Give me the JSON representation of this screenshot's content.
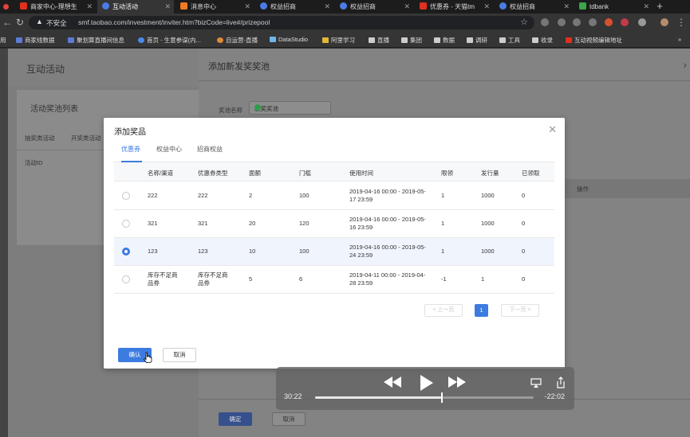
{
  "browser": {
    "tabs": [
      {
        "title": "商家中心-理想生",
        "icon": "taobao-t-icon",
        "active": false
      },
      {
        "title": "互动活动",
        "icon": "workbench-icon",
        "active": true
      },
      {
        "title": "消息中心",
        "icon": "message-icon",
        "active": false
      },
      {
        "title": "权益招商",
        "icon": "workbench-icon",
        "active": false
      },
      {
        "title": "权益招商",
        "icon": "workbench-icon",
        "active": false
      },
      {
        "title": "优惠券 - 天猫tm",
        "icon": "taobao-t-icon",
        "active": false
      },
      {
        "title": "权益招商",
        "icon": "workbench-icon",
        "active": false
      },
      {
        "title": "tdbank",
        "icon": "tdbank-icon",
        "active": false
      }
    ],
    "security_label": "不安全",
    "url": "smf.taobao.com/investment/inviter.htm?bizCode=live#/prizepool",
    "bookmarks": [
      "用",
      "商家线数据",
      "聚划算直播间信息",
      "首页 - 生意参谋(内...",
      "自运营-直播",
      "DataStudio",
      "阿里学习",
      "直播",
      "集团",
      "数据",
      "调研",
      "工具",
      "收录",
      "互动视频编辑地址"
    ]
  },
  "background": {
    "page_title": "互动活动",
    "card_title": "活动奖池列表",
    "card_tabs": [
      "抽奖类活动",
      "开奖类活动"
    ],
    "card_column": "活动ID",
    "drawer_title": "添加新发奖奖池",
    "pool_name_label": "奖池名称",
    "pool_name_value": "发奖奖池",
    "ops_label": "操作",
    "confirm_label": "确定",
    "cancel_label": "取消"
  },
  "modal": {
    "title": "添加奖品",
    "tabs": [
      "优惠券",
      "权益中心",
      "招商权益"
    ],
    "columns": [
      "名称/渠道",
      "优惠券类型",
      "面额",
      "门槛",
      "使用时间",
      "限领",
      "发行量",
      "已领取"
    ],
    "rows": [
      {
        "name": "222",
        "type": "222",
        "amount": "2",
        "threshold": "100",
        "time": "2019-04-16 00:00 - 2019-05-17 23:59",
        "limit": "1",
        "issued": "1000",
        "claimed": "0",
        "selected": false
      },
      {
        "name": "321",
        "type": "321",
        "amount": "20",
        "threshold": "120",
        "time": "2019-04-16 00:00 - 2019-05-16 23:59",
        "limit": "1",
        "issued": "1000",
        "claimed": "0",
        "selected": false
      },
      {
        "name": "123",
        "type": "123",
        "amount": "10",
        "threshold": "100",
        "time": "2019-04-16 00:00 - 2019-05-24 23:59",
        "limit": "1",
        "issued": "1000",
        "claimed": "0",
        "selected": true
      },
      {
        "name": "库存不足商品券",
        "type": "库存不足商品券",
        "amount": "5",
        "threshold": "6",
        "time": "2019-04-11 00:00 - 2019-04-28 23:59",
        "limit": "-1",
        "issued": "1",
        "claimed": "0",
        "selected": false
      }
    ],
    "pager": {
      "prev": "< 上一页",
      "page": "1",
      "next": "下一页 >"
    },
    "confirm_label": "确认",
    "cancel_label": "取消"
  },
  "video": {
    "elapsed": "30:22",
    "remaining": "-22:02",
    "progress": 0.58
  },
  "colors": {
    "accent": "#3c7be0",
    "selected_row": "#f0f5fd"
  }
}
